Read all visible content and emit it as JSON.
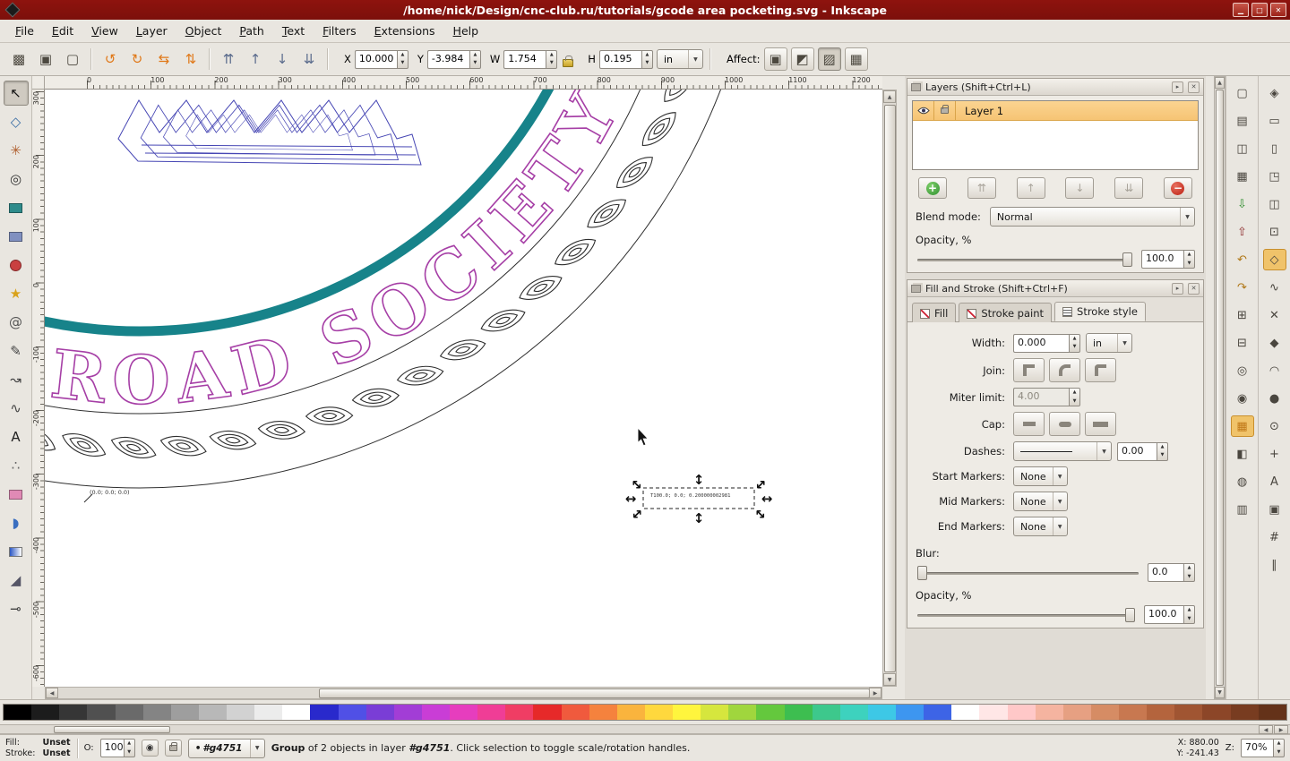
{
  "window": {
    "title": "/home/nick/Design/cnc-club.ru/tutorials/gcode area pocketing.svg - Inkscape"
  },
  "menu": {
    "items": [
      "File",
      "Edit",
      "View",
      "Layer",
      "Object",
      "Path",
      "Text",
      "Filters",
      "Extensions",
      "Help"
    ]
  },
  "toolbar": {
    "select_buttons": [
      {
        "name": "select-all-button",
        "glyph": "▩"
      },
      {
        "name": "select-all-layers-button",
        "glyph": "▣"
      },
      {
        "name": "deselect-button",
        "glyph": "▢"
      }
    ],
    "transform_buttons": [
      {
        "name": "rotate-ccw-button",
        "glyph": "↺",
        "color": "#e07818"
      },
      {
        "name": "rotate-cw-button",
        "glyph": "↻",
        "color": "#e07818"
      },
      {
        "name": "flip-horizontal-button",
        "glyph": "⇆",
        "color": "#e07818"
      },
      {
        "name": "flip-vertical-button",
        "glyph": "⇅",
        "color": "#e07818"
      }
    ],
    "zorder_buttons": [
      {
        "name": "raise-to-top-button",
        "glyph": "⇈",
        "color": "#5a6b8c"
      },
      {
        "name": "raise-button",
        "glyph": "↑",
        "color": "#5a6b8c"
      },
      {
        "name": "lower-button",
        "glyph": "↓",
        "color": "#5a6b8c"
      },
      {
        "name": "lower-to-bottom-button",
        "glyph": "⇊",
        "color": "#5a6b8c"
      }
    ],
    "x_label": "X",
    "x_value": "10.000",
    "y_label": "Y",
    "y_value": "-3.984",
    "w_label": "W",
    "w_value": "1.754",
    "h_label": "H",
    "h_value": "0.195",
    "units_value": "in",
    "affect_label": "Affect:",
    "affect_buttons": [
      {
        "name": "affect-stroke-toggle",
        "glyph": "▣"
      },
      {
        "name": "affect-corners-toggle",
        "glyph": "◩"
      },
      {
        "name": "affect-gradients-toggle",
        "glyph": "▨",
        "active": true
      },
      {
        "name": "affect-patterns-toggle",
        "glyph": "▦"
      }
    ]
  },
  "toolbox": {
    "tools": [
      {
        "name": "selector-tool",
        "glyph": "↖",
        "color": "#111",
        "active": true
      },
      {
        "name": "node-tool",
        "glyph": "◇",
        "color": "#3a6ea5"
      },
      {
        "name": "tweak-tool",
        "glyph": "✳",
        "color": "#b06030"
      },
      {
        "name": "zoom-tool",
        "glyph": "◎",
        "color": "#333"
      },
      {
        "name": "rect-tool",
        "shape": "rect",
        "color": "#2e8b8b"
      },
      {
        "name": "box3d-tool",
        "shape": "rect",
        "color": "#8090c0"
      },
      {
        "name": "ellipse-tool",
        "shape": "circle",
        "color": "#c94040"
      },
      {
        "name": "star-tool",
        "glyph": "★",
        "color": "#d9a21a"
      },
      {
        "name": "spiral-tool",
        "glyph": "@",
        "color": "#555"
      },
      {
        "name": "pencil-tool",
        "glyph": "✎",
        "color": "#444"
      },
      {
        "name": "pen-tool",
        "glyph": "↝",
        "color": "#444"
      },
      {
        "name": "calligraphy-tool",
        "glyph": "∿",
        "color": "#444"
      },
      {
        "name": "text-tool",
        "glyph": "A",
        "color": "#222"
      },
      {
        "name": "spray-tool",
        "glyph": "∴",
        "color": "#666"
      },
      {
        "name": "eraser-tool",
        "shape": "rect",
        "color": "#e08ab5"
      },
      {
        "name": "bucket-tool",
        "glyph": "◗",
        "color": "#3a6ec0"
      },
      {
        "name": "gradient-tool",
        "shape": "gradient"
      },
      {
        "name": "dropper-tool",
        "glyph": "◢",
        "color": "#556"
      },
      {
        "name": "connector-tool",
        "glyph": "⊸",
        "color": "#444"
      }
    ]
  },
  "rulers": {
    "top_labels": [
      "0",
      "100",
      "200",
      "300",
      "400",
      "500",
      "600",
      "700",
      "800",
      "900",
      "1000",
      "1100",
      "1200"
    ],
    "left_labels": [
      "300",
      "200",
      "100",
      "0",
      "-100",
      "-200",
      "-300",
      "-400",
      "-500",
      "-600"
    ]
  },
  "canvas": {
    "seal_text": "ROAD SOCIETY",
    "origin_label": "(0.0; 0.0; 0.0)",
    "selection_label": "T100.0; 0.0; 0.200000002981",
    "handle_h": "↔",
    "handle_v": "↕",
    "leaves": {
      "start": 22,
      "step": 4.9,
      "count": 17
    },
    "colors": {
      "teal": "#17838a",
      "seal": "#a63fa6",
      "line": "#2e2e2e",
      "toolpath": "#4646b4"
    }
  },
  "ui_colors": {
    "titlebar": "#8e130e",
    "selection": "#f6c474"
  },
  "layers_panel": {
    "title": "Layers (Shift+Ctrl+L)",
    "layer_name": "Layer 1",
    "buttons": {
      "add": "+",
      "top": "⇈",
      "raise": "↑",
      "lower": "↓",
      "bottom": "⇊",
      "del": "−"
    },
    "blend_label": "Blend mode:",
    "blend_value": "Normal",
    "opacity_label": "Opacity, %",
    "opacity_value": "100.0"
  },
  "fill_stroke_panel": {
    "title": "Fill and Stroke (Shift+Ctrl+F)",
    "tab_fill": "Fill",
    "tab_stroke_paint": "Stroke paint",
    "tab_stroke_style": "Stroke style",
    "width_label": "Width:",
    "width_value": "0.000",
    "width_unit": "in",
    "join_label": "Join:",
    "miter_label": "Miter limit:",
    "miter_value": "4.00",
    "cap_label": "Cap:",
    "dashes_label": "Dashes:",
    "dashes_value": "0.00",
    "start_markers_label": "Start Markers:",
    "start_markers_value": "None",
    "mid_markers_label": "Mid Markers:",
    "mid_markers_value": "None",
    "end_markers_label": "End Markers:",
    "end_markers_value": "None",
    "blur_label": "Blur:",
    "blur_value": "0.0",
    "opacity_label": "Opacity, %",
    "opacity_value": "100.0"
  },
  "commands_bar": {
    "items": [
      {
        "name": "new-document-button",
        "glyph": "▢"
      },
      {
        "name": "open-document-button",
        "glyph": "▤"
      },
      {
        "name": "save-document-button",
        "glyph": "◫"
      },
      {
        "name": "print-button",
        "glyph": "▦"
      },
      {
        "name": "import-button",
        "glyph": "⇩",
        "color": "#2f8f2f"
      },
      {
        "name": "export-button",
        "glyph": "⇧",
        "color": "#8f2f2f"
      },
      {
        "name": "undo-button",
        "glyph": "↶",
        "color": "#b07818"
      },
      {
        "name": "redo-button",
        "glyph": "↷",
        "color": "#b07818"
      },
      {
        "name": "copy-button",
        "glyph": "⊞"
      },
      {
        "name": "paste-button",
        "glyph": "⊟"
      },
      {
        "name": "zoom-drawing-button",
        "glyph": "◎"
      },
      {
        "name": "zoom-selection-button",
        "glyph": "◉"
      },
      {
        "name": "toggle-grid-button",
        "glyph": "▦",
        "color": "#c07818",
        "active": true
      },
      {
        "name": "toggle-guides-button",
        "glyph": "◧"
      },
      {
        "name": "fill-stroke-dialog-button",
        "glyph": "◍"
      },
      {
        "name": "align-dialog-button",
        "glyph": "▥"
      }
    ]
  },
  "snap_bar": {
    "items": [
      {
        "name": "snap-enable-button",
        "glyph": "◈"
      },
      {
        "name": "snap-bbox-button",
        "glyph": "▭"
      },
      {
        "name": "snap-bbox-edges-button",
        "glyph": "▯"
      },
      {
        "name": "snap-bbox-corners-button",
        "glyph": "◳"
      },
      {
        "name": "snap-edge-midpoints-button",
        "glyph": "◫"
      },
      {
        "name": "snap-centers-button",
        "glyph": "⊡"
      },
      {
        "name": "snap-nodes-button",
        "glyph": "◇",
        "active": true
      },
      {
        "name": "snap-paths-button",
        "glyph": "∿"
      },
      {
        "name": "snap-intersections-button",
        "glyph": "✕"
      },
      {
        "name": "snap-cusp-nodes-button",
        "glyph": "◆"
      },
      {
        "name": "snap-smooth-nodes-button",
        "glyph": "◠"
      },
      {
        "name": "snap-midpoints-button",
        "glyph": "●"
      },
      {
        "name": "snap-object-centers-button",
        "glyph": "⊙"
      },
      {
        "name": "snap-rotation-center-button",
        "glyph": "+"
      },
      {
        "name": "snap-text-baseline-button",
        "glyph": "A"
      },
      {
        "name": "snap-page-border-button",
        "glyph": "▣"
      },
      {
        "name": "snap-grid-button",
        "glyph": "#"
      },
      {
        "name": "snap-guides-button",
        "glyph": "∥"
      }
    ]
  },
  "palette": {
    "colors": [
      "#000000",
      "#1c1c1c",
      "#363636",
      "#505050",
      "#6a6a6a",
      "#848484",
      "#9e9e9e",
      "#b8b8b8",
      "#d2d2d2",
      "#ececec",
      "#ffffff",
      "#2929cc",
      "#5050e6",
      "#7a3dd6",
      "#a23dd6",
      "#c93dd6",
      "#e63dbe",
      "#f03d96",
      "#f03d64",
      "#e62929",
      "#f05a3d",
      "#f5823d",
      "#fab43d",
      "#ffd83d",
      "#fff53d",
      "#d6e63d",
      "#a0d63d",
      "#64c83d",
      "#3dbe50",
      "#3dc88c",
      "#3dd2be",
      "#3dc8e6",
      "#3d96f0",
      "#3d64e6",
      "#ffffff",
      "#ffe6e6",
      "#ffc8c8",
      "#f5b4a0",
      "#e6a082",
      "#d68c64",
      "#c87850",
      "#b4643d",
      "#a05532",
      "#8c4628",
      "#783c20",
      "#643219"
    ]
  },
  "status_bar": {
    "fill_label": "Fill:",
    "fill_value": "Unset",
    "stroke_label": "Stroke:",
    "stroke_value": "Unset",
    "opacity_label": "O:",
    "opacity_value": "100",
    "layer_value": "#g4751",
    "message_p1": "Group",
    "message_p2": " of 2 objects in layer ",
    "message_p3": "#g4751",
    "message_p4": ". Click selection to toggle scale/rotation handles.",
    "x_label": "X:",
    "x_value": "880.00",
    "y_label": "Y:",
    "y_value": "-241.43",
    "z_label": "Z:",
    "z_value": "70%"
  }
}
